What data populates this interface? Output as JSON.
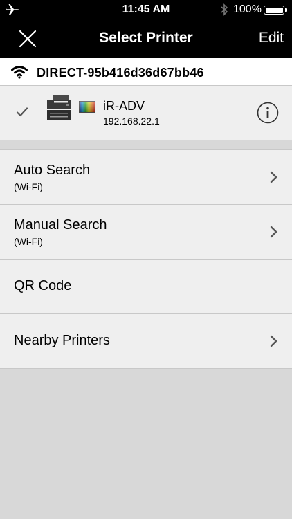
{
  "status_bar": {
    "time": "11:45 AM",
    "battery": "100%",
    "icons": [
      "airplane-icon",
      "bluetooth-icon",
      "battery-icon"
    ]
  },
  "nav": {
    "title": "Select Printer",
    "edit": "Edit",
    "close_icon": "close-icon"
  },
  "network": {
    "ssid": "DIRECT-95b416d36d67bb46",
    "icon": "wifi-icon"
  },
  "printer": {
    "name": "iR-ADV",
    "ip": "192.168.22.1",
    "selected": true,
    "icons": [
      "checkmark-icon",
      "printer-icon",
      "color-icon",
      "info-icon"
    ]
  },
  "menu": {
    "items": [
      {
        "label": "Auto Search",
        "sub": "(Wi-Fi)",
        "chevron": true
      },
      {
        "label": "Manual Search",
        "sub": "(Wi-Fi)",
        "chevron": true
      },
      {
        "label": "QR Code",
        "sub": "",
        "chevron": false
      },
      {
        "label": "Nearby Printers",
        "sub": "",
        "chevron": true
      }
    ]
  },
  "colors": {
    "bar": "#000000",
    "row_bg": "#efefef",
    "background": "#d8d8d8",
    "divider": "#c8c8c8"
  }
}
